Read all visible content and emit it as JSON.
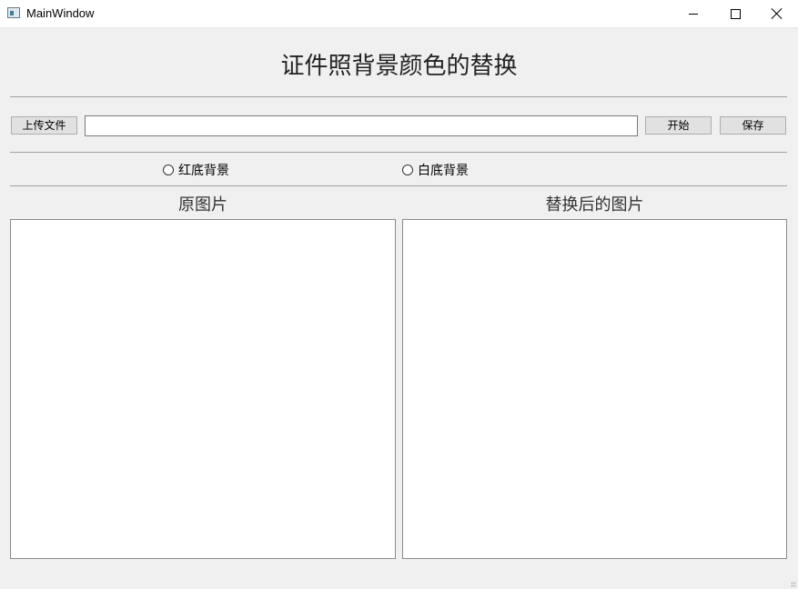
{
  "window": {
    "title": "MainWindow"
  },
  "heading": "证件照背景颜色的替换",
  "toolbar": {
    "upload_label": "上传文件",
    "file_path_value": "",
    "start_label": "开始",
    "save_label": "保存"
  },
  "background_options": [
    {
      "label": "红底背景",
      "checked": false
    },
    {
      "label": "白底背景",
      "checked": false
    }
  ],
  "panels": {
    "original_label": "原图片",
    "result_label": "替换后的图片"
  }
}
